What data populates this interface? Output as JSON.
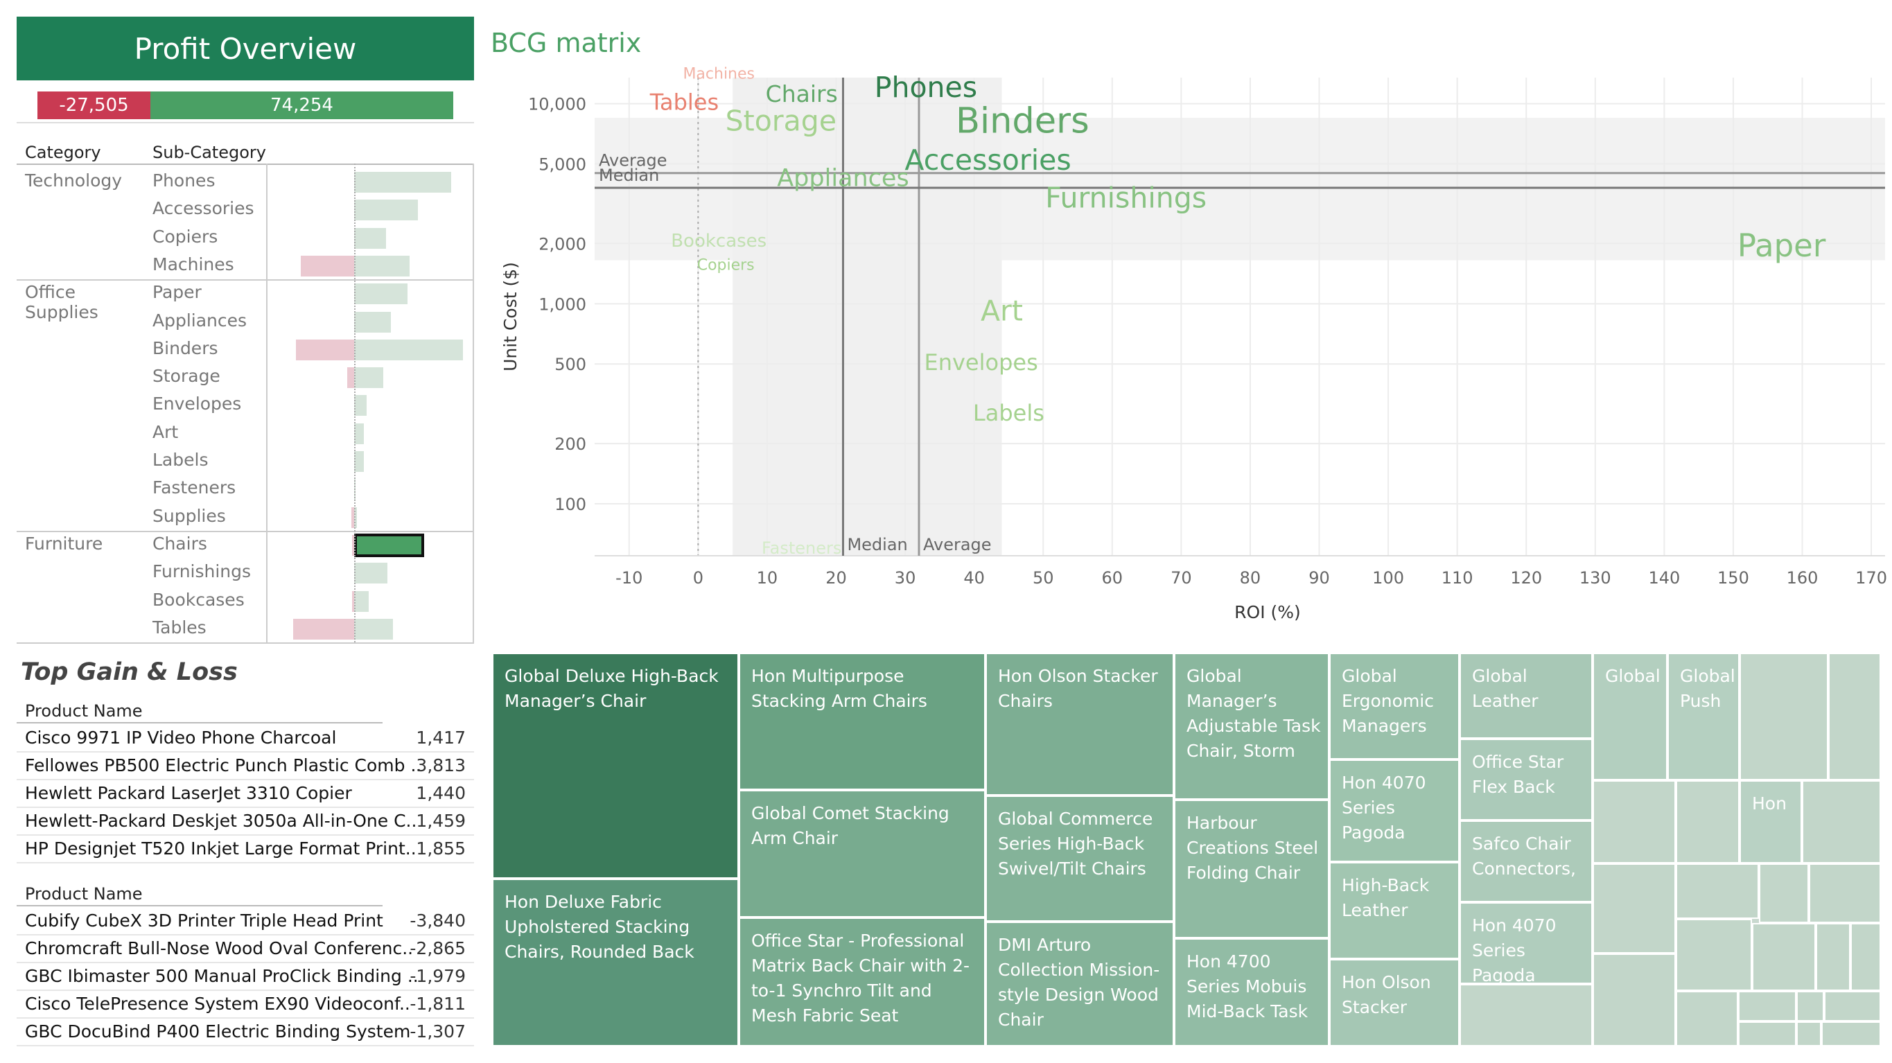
{
  "profit_overview": {
    "title": "Profit Overview",
    "total_loss": "-27,505",
    "total_gain": "74,254",
    "col_category": "Category",
    "col_subcategory": "Sub-Category",
    "categories": [
      {
        "name": "Technology",
        "subs": [
          {
            "name": "Phones",
            "pos": 1.0,
            "neg": 0
          },
          {
            "name": "Accessories",
            "pos": 0.66,
            "neg": 0
          },
          {
            "name": "Copiers",
            "pos": 0.33,
            "neg": 0
          },
          {
            "name": "Machines",
            "pos": 0.57,
            "neg": 0.55
          }
        ]
      },
      {
        "name": "Office Supplies",
        "subs": [
          {
            "name": "Paper",
            "pos": 0.55,
            "neg": 0
          },
          {
            "name": "Appliances",
            "pos": 0.38,
            "neg": 0
          },
          {
            "name": "Binders",
            "pos": 1.12,
            "neg": 0.6
          },
          {
            "name": "Storage",
            "pos": 0.3,
            "neg": 0.07
          },
          {
            "name": "Envelopes",
            "pos": 0.13,
            "neg": 0
          },
          {
            "name": "Art",
            "pos": 0.1,
            "neg": 0
          },
          {
            "name": "Labels",
            "pos": 0.1,
            "neg": 0
          },
          {
            "name": "Fasteners",
            "pos": 0.01,
            "neg": 0
          },
          {
            "name": "Supplies",
            "pos": 0.03,
            "neg": 0.03
          }
        ]
      },
      {
        "name": "Furniture",
        "subs": [
          {
            "name": "Chairs",
            "pos": 0.72,
            "neg": 0.02,
            "selected": true
          },
          {
            "name": "Furnishings",
            "pos": 0.34,
            "neg": 0
          },
          {
            "name": "Bookcases",
            "pos": 0.15,
            "neg": 0.02
          },
          {
            "name": "Tables",
            "pos": 0.4,
            "neg": 0.63
          }
        ]
      }
    ]
  },
  "top_gain_loss": {
    "title": "Top Gain & Loss",
    "col_product": "Product Name",
    "gains": [
      {
        "name": "Cisco 9971 IP Video Phone Charcoal",
        "value": "1,417"
      },
      {
        "name": "Fellowes PB500 Electric Punch Plastic Comb ..",
        "value": "3,813"
      },
      {
        "name": "Hewlett Packard LaserJet 3310 Copier",
        "value": "1,440"
      },
      {
        "name": "Hewlett-Packard Deskjet 3050a All-in-One C..",
        "value": "1,459"
      },
      {
        "name": "HP Designjet T520 Inkjet Large Format Print..",
        "value": "1,855"
      }
    ],
    "losses": [
      {
        "name": "Cubify CubeX 3D Printer Triple Head Print",
        "value": "-3,840"
      },
      {
        "name": "Chromcraft Bull-Nose Wood Oval Conferenc..",
        "value": "-2,865"
      },
      {
        "name": "GBC Ibimaster 500 Manual ProClick Binding ..",
        "value": "-1,979"
      },
      {
        "name": "Cisco TelePresence System EX90 Videoconf..",
        "value": "-1,811"
      },
      {
        "name": "GBC DocuBind P400 Electric Binding System",
        "value": "-1,307"
      }
    ]
  },
  "chart_data": {
    "type": "scatter",
    "title": "BCG matrix",
    "xlabel": "ROI  (%)",
    "ylabel": "Unit Cost ($)",
    "x_scale": "linear",
    "y_scale": "log",
    "xlim": [
      -15,
      172
    ],
    "ylim": [
      55,
      13500
    ],
    "x_ticks": [
      -10,
      0,
      10,
      20,
      30,
      40,
      50,
      60,
      70,
      80,
      90,
      100,
      110,
      120,
      130,
      140,
      150,
      160,
      170
    ],
    "y_ticks": [
      100,
      200,
      500,
      1000,
      2000,
      5000,
      10000
    ],
    "y_tick_labels": [
      "100",
      "200",
      "500",
      "1,000",
      "2,000",
      "5,000",
      "10,000"
    ],
    "reference_lines": {
      "x_median": 21,
      "x_average": 32,
      "y_average": 4500,
      "y_median": 3800,
      "x_median_label": "Median",
      "x_average_label": "Average",
      "y_average_label": "Average",
      "y_median_label": "Median"
    },
    "colors": {
      "negative": "#e8806f",
      "positive_dark": "#2f7d4b",
      "positive_mid": "#62a86a",
      "positive_light": "#a5d28f",
      "negative_light": "#f2b3a6"
    },
    "points": [
      {
        "label": "Machines",
        "x": 3,
        "y": 14000,
        "size": 22,
        "color": "#f2b3a6"
      },
      {
        "label": "Tables",
        "x": -2,
        "y": 10000,
        "size": 32,
        "color": "#e8806f"
      },
      {
        "label": "Chairs",
        "x": 15,
        "y": 11000,
        "size": 33,
        "color": "#62a86a"
      },
      {
        "label": "Phones",
        "x": 33,
        "y": 11800,
        "size": 41,
        "color": "#2f7d4b"
      },
      {
        "label": "Storage",
        "x": 12,
        "y": 8000,
        "size": 41,
        "color": "#a5d28f"
      },
      {
        "label": "Binders",
        "x": 47,
        "y": 8000,
        "size": 51,
        "color": "#62a86a"
      },
      {
        "label": "Accessories",
        "x": 42,
        "y": 5100,
        "size": 41,
        "color": "#4aa064"
      },
      {
        "label": "Appliances",
        "x": 21,
        "y": 4200,
        "size": 35,
        "color": "#88c282"
      },
      {
        "label": "Furnishings",
        "x": 62,
        "y": 3300,
        "size": 41,
        "color": "#88c282"
      },
      {
        "label": "Bookcases",
        "x": 3,
        "y": 2050,
        "size": 26,
        "color": "#c1e0b0"
      },
      {
        "label": "Copiers",
        "x": 4,
        "y": 1550,
        "size": 22,
        "color": "#a5d28f"
      },
      {
        "label": "Paper",
        "x": 157,
        "y": 1900,
        "size": 45,
        "color": "#88c282"
      },
      {
        "label": "Art",
        "x": 44,
        "y": 900,
        "size": 41,
        "color": "#a5d28f"
      },
      {
        "label": "Envelopes",
        "x": 41,
        "y": 500,
        "size": 32,
        "color": "#a5d28f"
      },
      {
        "label": "Labels",
        "x": 45,
        "y": 280,
        "size": 32,
        "color": "#a5d28f"
      },
      {
        "label": "Fasteners",
        "x": 15,
        "y": 50,
        "size": 24,
        "color": "#d4ebc8"
      }
    ]
  },
  "treemap": {
    "cells": [
      {
        "label": "Global Deluxe High-Back Manager’s Chair",
        "color": "#3a7a5a"
      },
      {
        "label": "Hon Deluxe Fabric Upholstered Stacking Chairs, Rounded Back",
        "color": "#5a9579"
      },
      {
        "label": "Hon Multipurpose Stacking Arm Chairs",
        "color": "#6aa283"
      },
      {
        "label": "Global Comet Stacking Arm Chair",
        "color": "#78ab8f"
      },
      {
        "label": "Office Star - Professional Matrix Back Chair with 2-to-1 Synchro Tilt and Mesh Fabric Seat",
        "color": "#78ab8f"
      },
      {
        "label": "Hon Olson Stacker Chairs",
        "color": "#7dae93"
      },
      {
        "label": "Global Commerce Series High-Back Swivel/Tilt Chairs",
        "color": "#84b399"
      },
      {
        "label": "DMI Arturo Collection Mission-style Design Wood Chair",
        "color": "#84b399"
      },
      {
        "label": "Global Manager’s Adjustable Task Chair, Storm",
        "color": "#8ab79e"
      },
      {
        "label": "Harbour Creations Steel Folding Chair",
        "color": "#8fbaa2"
      },
      {
        "label": "Hon 4700 Series Mobuis Mid-Back Task",
        "color": "#92bca5"
      },
      {
        "label": "Global Ergonomic Managers",
        "color": "#9ac1ab"
      },
      {
        "label": "Hon 4070 Series Pagoda",
        "color": "#9ec4ae"
      },
      {
        "label": "High-Back Leather",
        "color": "#a2c6b1"
      },
      {
        "label": "Hon Olson Stacker",
        "color": "#a5c7b4"
      },
      {
        "label": "Global Leather",
        "color": "#a8c8b6"
      },
      {
        "label": "Office Star Flex Back",
        "color": "#abcab9"
      },
      {
        "label": "Safco Chair Connectors,",
        "color": "#adcbba"
      },
      {
        "label": "Hon 4070 Series Pagoda",
        "color": "#b0cdbd"
      },
      {
        "label": "Global",
        "color": "#b3cfbf"
      },
      {
        "label": "Global Push",
        "color": "#b5d0c1"
      },
      {
        "label": "Hon",
        "color": "#b9d2c4"
      }
    ]
  }
}
